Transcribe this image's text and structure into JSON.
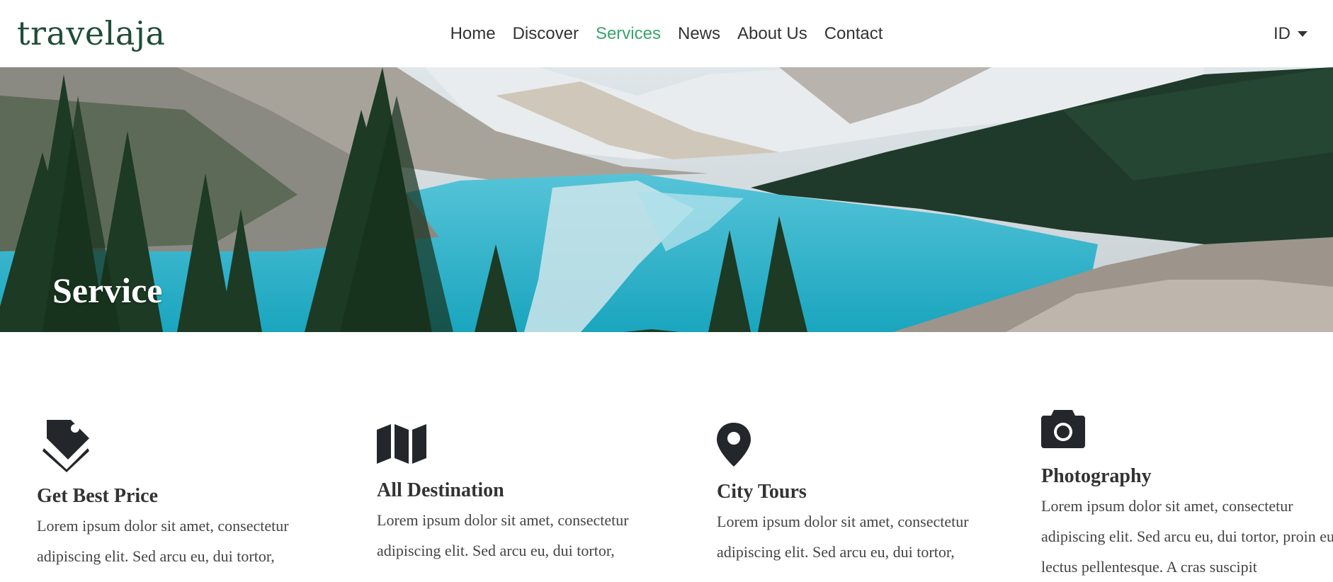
{
  "brand": "travelaja",
  "nav": {
    "items": [
      "Home",
      "Discover",
      "Services",
      "News",
      "About Us",
      "Contact"
    ],
    "active": "Services",
    "language": "ID"
  },
  "hero": {
    "title": "Service"
  },
  "services": [
    {
      "icon": "price-tags-icon",
      "title": "Get Best Price",
      "text": "Lorem ipsum dolor sit amet, consectetur adipiscing elit. Sed arcu eu, dui tortor,"
    },
    {
      "icon": "map-icon",
      "title": "All Destination",
      "text": "Lorem ipsum dolor sit amet, consectetur adipiscing elit. Sed arcu eu, dui tortor,"
    },
    {
      "icon": "map-pin-icon",
      "title": "City Tours",
      "text": "Lorem ipsum dolor sit amet, consectetur adipiscing elit. Sed arcu eu, dui tortor,"
    },
    {
      "icon": "camera-icon",
      "title": "Photography",
      "text": "Lorem ipsum dolor sit amet, consectetur adipiscing elit. Sed arcu eu, dui tortor, proin eu lectus pellentesque. A cras suscipit"
    }
  ],
  "colors": {
    "brand": "#1f4d3a",
    "nav_active": "#3aa46d",
    "text": "#333333",
    "icon": "#23272b"
  }
}
